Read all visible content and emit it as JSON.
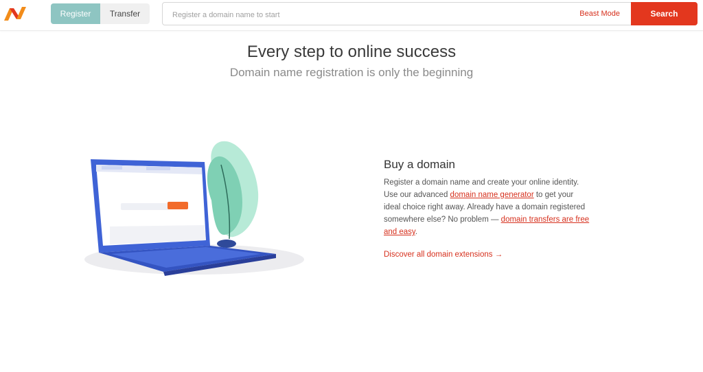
{
  "brand": {
    "logo": "N",
    "accent": "#e3371e",
    "teal": "#8ec5c2"
  },
  "header": {
    "tabs": [
      {
        "label": "Register",
        "active": true
      },
      {
        "label": "Transfer",
        "active": false
      }
    ],
    "search": {
      "placeholder": "Register a domain name to start",
      "value": ""
    },
    "beast_mode": "Beast Mode",
    "search_button": "Search"
  },
  "hero": {
    "title": "Every step to online success",
    "subtitle": "Domain name registration is only the beginning"
  },
  "feature": {
    "title": "Buy a domain",
    "text_1": "Register a domain name and create your online identity. Use our advanced ",
    "link_1": "domain name generator",
    "text_2": " to get your ideal choice right away. Already have a domain registered somewhere else? No problem — ",
    "link_2": "domain transfers are free and easy",
    "text_3": ".",
    "cta": "Discover all domain extensions →"
  }
}
